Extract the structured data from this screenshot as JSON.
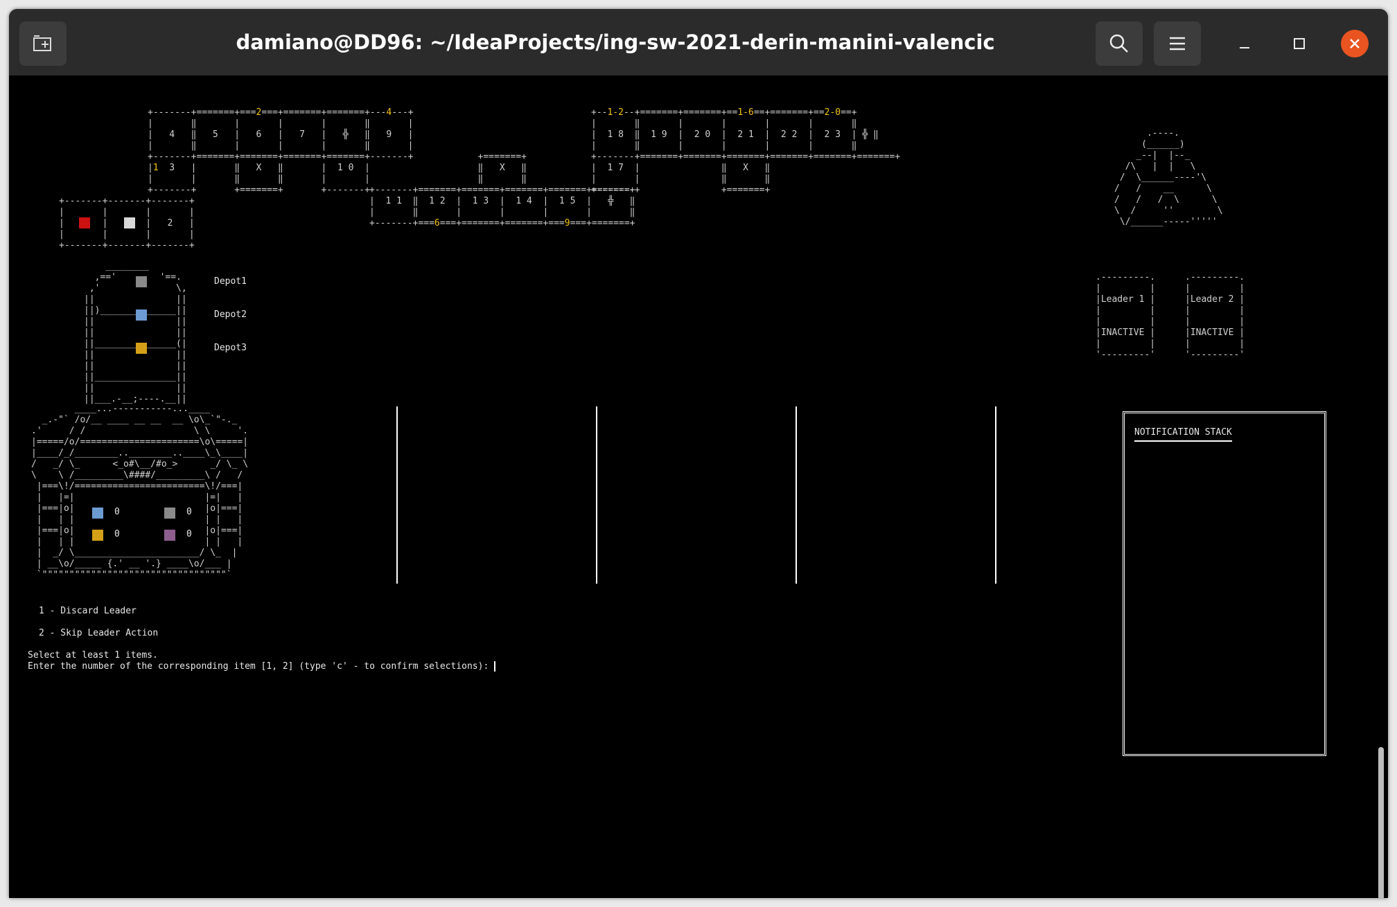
{
  "window": {
    "title": "damiano@DD96: ~/IdeaProjects/ing-sw-2021-derin-manini-valencic",
    "buttons": [
      "new-tab",
      "search",
      "menu",
      "minimize",
      "maximize",
      "close"
    ]
  },
  "faith_track": {
    "vatican_reports": [
      "2",
      "4",
      "1-2",
      "1-6",
      "2-0",
      "6",
      "9"
    ],
    "player_marker_label": "1",
    "cells": [
      "2",
      "3",
      "4",
      "5",
      "6",
      "7",
      "9",
      "10",
      "11",
      "12",
      "13",
      "14",
      "15",
      "17",
      "18",
      "19",
      "20",
      "21",
      "22",
      "23"
    ],
    "pope_tiles": [
      "X",
      "X",
      "X"
    ],
    "colors": {
      "pope_active": "#cc1111",
      "pope_inactive": "#d8d8d8",
      "highlight": "#f5c518"
    }
  },
  "depots": {
    "labels": [
      "Depot1",
      "Depot2",
      "Depot3"
    ],
    "colors": [
      "#8a8a8a",
      "#6c9bd2",
      "#d4a017"
    ]
  },
  "strongbox": {
    "resources": [
      {
        "color": "#6c9bd2",
        "count": "0"
      },
      {
        "color": "#8a8a8a",
        "count": "0"
      },
      {
        "color": "#d4a017",
        "count": "0"
      },
      {
        "color": "#8e5f8e",
        "count": "0"
      }
    ]
  },
  "leaders": [
    {
      "name": "Leader 1",
      "status": "INACTIVE"
    },
    {
      "name": "Leader 2",
      "status": "INACTIVE"
    }
  ],
  "notification": {
    "title": "NOTIFICATION STACK"
  },
  "prompt": {
    "options": [
      "1 - Discard Leader",
      "2 - Skip Leader Action"
    ],
    "instruction": "Select at least 1 items.",
    "input_line": "Enter the number of the corresponding item [1, 2] (type 'c' - to confirm selections): "
  }
}
